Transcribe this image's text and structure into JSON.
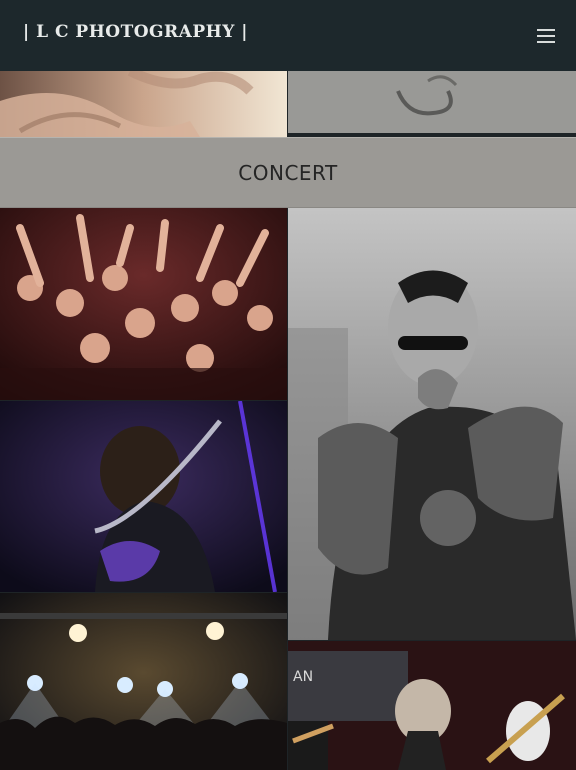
{
  "site": {
    "brand": "| L C PHOTOGRAPHY |"
  },
  "header": {
    "menu_icon": "hamburger-menu-icon"
  },
  "gallery": {
    "section_title": "CONCERT",
    "top_photos": [
      {
        "name": "hands-photo"
      },
      {
        "name": "sand-heart-photo"
      }
    ],
    "photos": [
      {
        "name": "crowd-photo"
      },
      {
        "name": "singer-bw-photo"
      },
      {
        "name": "guitarist-purple-photo"
      },
      {
        "name": "stage-lights-crowd-photo"
      },
      {
        "name": "band-stage-photo"
      }
    ]
  },
  "colors": {
    "header_bg": "#1d282c",
    "section_bg": "#9b9995",
    "brand_text": "#e8ebea"
  }
}
